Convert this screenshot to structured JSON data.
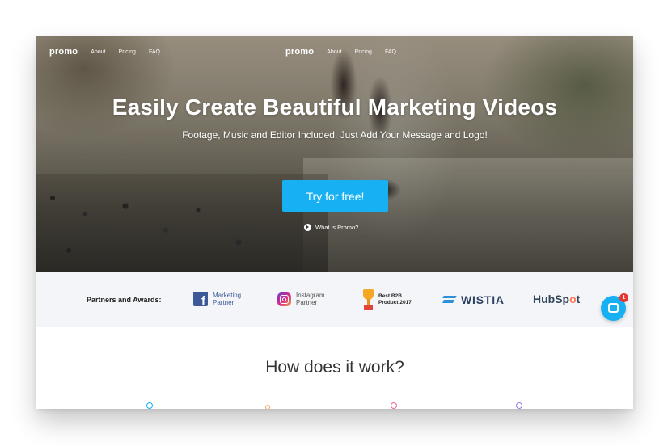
{
  "nav_left": {
    "logo": "promo",
    "items": [
      "About",
      "Pricing",
      "FAQ"
    ]
  },
  "nav_center": {
    "logo": "promo",
    "items": [
      "About",
      "Pricing",
      "FAQ"
    ]
  },
  "hero": {
    "title": "Easily Create Beautiful Marketing Videos",
    "subtitle": "Footage, Music and Editor Included. Just Add Your Message and Logo!",
    "cta_label": "Try for free!",
    "what_is_label": "What is Promo?",
    "cta_color": "#17b1f3"
  },
  "partners": {
    "label": "Partners and Awards:",
    "facebook": {
      "line1": "Marketing",
      "line2": "Partner",
      "icon": "facebook-icon"
    },
    "instagram": {
      "line1": "Instagram",
      "line2": "Partner",
      "icon": "instagram-icon"
    },
    "b2b": {
      "line1": "Best B2B",
      "line2": "Product 2017",
      "icon": "trophy-icon"
    },
    "wistia": {
      "name": "WISTIA",
      "icon": "wistia-icon"
    },
    "hubspot": {
      "pre": "HubSp",
      "o": "o",
      "post": "t"
    }
  },
  "how": {
    "title": "How does it work?"
  },
  "chat": {
    "badge": "1",
    "icon": "chat-icon"
  }
}
